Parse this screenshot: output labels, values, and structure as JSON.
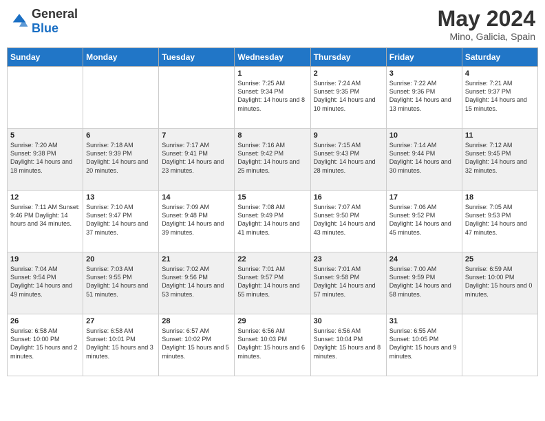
{
  "header": {
    "logo_general": "General",
    "logo_blue": "Blue",
    "month": "May 2024",
    "location": "Mino, Galicia, Spain"
  },
  "weekdays": [
    "Sunday",
    "Monday",
    "Tuesday",
    "Wednesday",
    "Thursday",
    "Friday",
    "Saturday"
  ],
  "weeks": [
    [
      {
        "day": "",
        "content": ""
      },
      {
        "day": "",
        "content": ""
      },
      {
        "day": "",
        "content": ""
      },
      {
        "day": "1",
        "content": "Sunrise: 7:25 AM\nSunset: 9:34 PM\nDaylight: 14 hours\nand 8 minutes."
      },
      {
        "day": "2",
        "content": "Sunrise: 7:24 AM\nSunset: 9:35 PM\nDaylight: 14 hours\nand 10 minutes."
      },
      {
        "day": "3",
        "content": "Sunrise: 7:22 AM\nSunset: 9:36 PM\nDaylight: 14 hours\nand 13 minutes."
      },
      {
        "day": "4",
        "content": "Sunrise: 7:21 AM\nSunset: 9:37 PM\nDaylight: 14 hours\nand 15 minutes."
      }
    ],
    [
      {
        "day": "5",
        "content": "Sunrise: 7:20 AM\nSunset: 9:38 PM\nDaylight: 14 hours\nand 18 minutes."
      },
      {
        "day": "6",
        "content": "Sunrise: 7:18 AM\nSunset: 9:39 PM\nDaylight: 14 hours\nand 20 minutes."
      },
      {
        "day": "7",
        "content": "Sunrise: 7:17 AM\nSunset: 9:41 PM\nDaylight: 14 hours\nand 23 minutes."
      },
      {
        "day": "8",
        "content": "Sunrise: 7:16 AM\nSunset: 9:42 PM\nDaylight: 14 hours\nand 25 minutes."
      },
      {
        "day": "9",
        "content": "Sunrise: 7:15 AM\nSunset: 9:43 PM\nDaylight: 14 hours\nand 28 minutes."
      },
      {
        "day": "10",
        "content": "Sunrise: 7:14 AM\nSunset: 9:44 PM\nDaylight: 14 hours\nand 30 minutes."
      },
      {
        "day": "11",
        "content": "Sunrise: 7:12 AM\nSunset: 9:45 PM\nDaylight: 14 hours\nand 32 minutes."
      }
    ],
    [
      {
        "day": "12",
        "content": "Sunrise: 7:11 AM\nSunset: 9:46 PM\nDaylight: 14 hours\nand 34 minutes."
      },
      {
        "day": "13",
        "content": "Sunrise: 7:10 AM\nSunset: 9:47 PM\nDaylight: 14 hours\nand 37 minutes."
      },
      {
        "day": "14",
        "content": "Sunrise: 7:09 AM\nSunset: 9:48 PM\nDaylight: 14 hours\nand 39 minutes."
      },
      {
        "day": "15",
        "content": "Sunrise: 7:08 AM\nSunset: 9:49 PM\nDaylight: 14 hours\nand 41 minutes."
      },
      {
        "day": "16",
        "content": "Sunrise: 7:07 AM\nSunset: 9:50 PM\nDaylight: 14 hours\nand 43 minutes."
      },
      {
        "day": "17",
        "content": "Sunrise: 7:06 AM\nSunset: 9:52 PM\nDaylight: 14 hours\nand 45 minutes."
      },
      {
        "day": "18",
        "content": "Sunrise: 7:05 AM\nSunset: 9:53 PM\nDaylight: 14 hours\nand 47 minutes."
      }
    ],
    [
      {
        "day": "19",
        "content": "Sunrise: 7:04 AM\nSunset: 9:54 PM\nDaylight: 14 hours\nand 49 minutes."
      },
      {
        "day": "20",
        "content": "Sunrise: 7:03 AM\nSunset: 9:55 PM\nDaylight: 14 hours\nand 51 minutes."
      },
      {
        "day": "21",
        "content": "Sunrise: 7:02 AM\nSunset: 9:56 PM\nDaylight: 14 hours\nand 53 minutes."
      },
      {
        "day": "22",
        "content": "Sunrise: 7:01 AM\nSunset: 9:57 PM\nDaylight: 14 hours\nand 55 minutes."
      },
      {
        "day": "23",
        "content": "Sunrise: 7:01 AM\nSunset: 9:58 PM\nDaylight: 14 hours\nand 57 minutes."
      },
      {
        "day": "24",
        "content": "Sunrise: 7:00 AM\nSunset: 9:59 PM\nDaylight: 14 hours\nand 58 minutes."
      },
      {
        "day": "25",
        "content": "Sunrise: 6:59 AM\nSunset: 10:00 PM\nDaylight: 15 hours\nand 0 minutes."
      }
    ],
    [
      {
        "day": "26",
        "content": "Sunrise: 6:58 AM\nSunset: 10:00 PM\nDaylight: 15 hours\nand 2 minutes."
      },
      {
        "day": "27",
        "content": "Sunrise: 6:58 AM\nSunset: 10:01 PM\nDaylight: 15 hours\nand 3 minutes."
      },
      {
        "day": "28",
        "content": "Sunrise: 6:57 AM\nSunset: 10:02 PM\nDaylight: 15 hours\nand 5 minutes."
      },
      {
        "day": "29",
        "content": "Sunrise: 6:56 AM\nSunset: 10:03 PM\nDaylight: 15 hours\nand 6 minutes."
      },
      {
        "day": "30",
        "content": "Sunrise: 6:56 AM\nSunset: 10:04 PM\nDaylight: 15 hours\nand 8 minutes."
      },
      {
        "day": "31",
        "content": "Sunrise: 6:55 AM\nSunset: 10:05 PM\nDaylight: 15 hours\nand 9 minutes."
      },
      {
        "day": "",
        "content": ""
      }
    ]
  ]
}
